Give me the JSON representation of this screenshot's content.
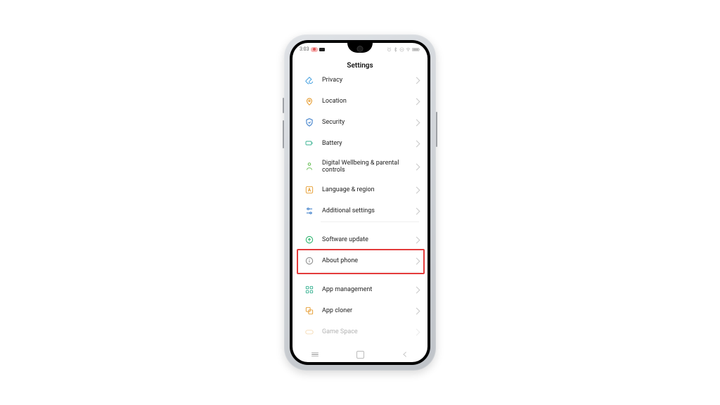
{
  "status": {
    "time": "3:03"
  },
  "header": {
    "title": "Settings"
  },
  "rows": {
    "privacy": {
      "label": "Privacy",
      "color": "#4aa3e0"
    },
    "location": {
      "label": "Location",
      "color": "#e69b2d"
    },
    "security": {
      "label": "Security",
      "color": "#3a7cc9"
    },
    "battery": {
      "label": "Battery",
      "color": "#34b08f"
    },
    "wellbeing": {
      "label": "Digital Wellbeing & parental controls",
      "color": "#6bbf59"
    },
    "language": {
      "label": "Language & region",
      "color": "#e69b2d"
    },
    "additional": {
      "label": "Additional settings",
      "color": "#3a7cc9"
    },
    "swupdate": {
      "label": "Software update",
      "color": "#2fb56f"
    },
    "about": {
      "label": "About phone",
      "color": "#8e8e8e"
    },
    "appmgmt": {
      "label": "App management",
      "color": "#34b08f"
    },
    "appcloner": {
      "label": "App cloner",
      "color": "#e69b2d"
    },
    "gamespace": {
      "label": "Game Space",
      "color": "#e69b2d"
    }
  },
  "highlight_target": "about"
}
